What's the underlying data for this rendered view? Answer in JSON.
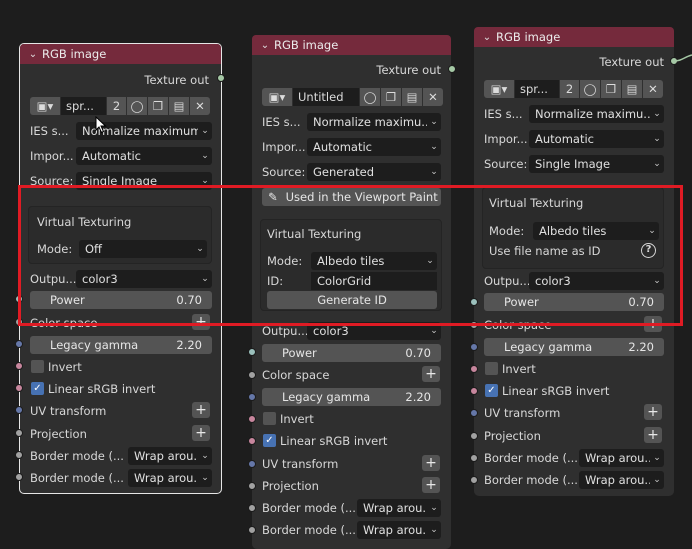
{
  "nodes": {
    "a": {
      "title": "RGB image",
      "texture_out": "Texture out",
      "image_name": "spr...",
      "users": "2",
      "ies_label": "IES s...",
      "ies_value": "Normalize maximum",
      "importance_label": "Impor...",
      "importance_value": "Automatic",
      "source_label": "Source:",
      "source_value": "Single Image",
      "vt_title": "Virtual Texturing",
      "mode_label": "Mode:",
      "mode_value": "Off",
      "output_label": "Outpu...",
      "output_value": "color3",
      "power_label": "Power",
      "power_value": "0.70",
      "colorspace_label": "Color space",
      "gamma_label": "Legacy gamma",
      "gamma_value": "2.20",
      "invert_label": "Invert",
      "linear_label": "Linear sRGB invert",
      "uv_label": "UV transform",
      "projection_label": "Projection",
      "border1_label": "Border mode (...",
      "border1_value": "Wrap arou...",
      "border2_label": "Border mode (...",
      "border2_value": "Wrap arou..."
    },
    "b": {
      "title": "RGB image",
      "texture_out": "Texture out",
      "image_name": "Untitled",
      "ies_label": "IES s...",
      "ies_value": "Normalize maximu...",
      "importance_label": "Impor...",
      "importance_value": "Automatic",
      "source_label": "Source:",
      "source_value": "Generated",
      "paint_button": "Used in the Viewport Paint",
      "vt_title": "Virtual Texturing",
      "mode_label": "Mode:",
      "mode_value": "Albedo tiles",
      "id_label": "ID:",
      "id_value": "ColorGrid",
      "generate_button": "Generate ID",
      "output_label": "Outpu...",
      "output_value": "color3",
      "power_label": "Power",
      "power_value": "0.70",
      "colorspace_label": "Color space",
      "gamma_label": "Legacy gamma",
      "gamma_value": "2.20",
      "invert_label": "Invert",
      "linear_label": "Linear sRGB invert",
      "uv_label": "UV transform",
      "projection_label": "Projection",
      "border1_label": "Border mode (...",
      "border1_value": "Wrap arou...",
      "border2_label": "Border mode (...",
      "border2_value": "Wrap arou..."
    },
    "c": {
      "title": "RGB image",
      "texture_out": "Texture out",
      "image_name": "spr...",
      "users": "2",
      "ies_label": "IES s...",
      "ies_value": "Normalize maximu...",
      "importance_label": "Impor...",
      "importance_value": "Automatic",
      "source_label": "Source:",
      "source_value": "Single Image",
      "vt_title": "Virtual Texturing",
      "mode_label": "Mode:",
      "mode_value": "Albedo tiles",
      "usefile_label": "Use file name as ID",
      "output_label": "Outpu...",
      "output_value": "color3",
      "power_label": "Power",
      "power_value": "0.70",
      "colorspace_label": "Color space",
      "gamma_label": "Legacy gamma",
      "gamma_value": "2.20",
      "invert_label": "Invert",
      "linear_label": "Linear sRGB invert",
      "uv_label": "UV transform",
      "projection_label": "Projection",
      "border1_label": "Border mode (...",
      "border1_value": "Wrap arou...",
      "border2_label": "Border mode (...",
      "border2_value": "Wrap arou..."
    }
  },
  "colors": {
    "header": "#752a3c",
    "highlight": "#e01b24",
    "checkbox_on": "#4772b3",
    "socket_texture": "#a5c8a5",
    "socket_value": "#a1a1a1",
    "socket_vector": "#6577a8",
    "socket_bool": "#c7869d"
  }
}
